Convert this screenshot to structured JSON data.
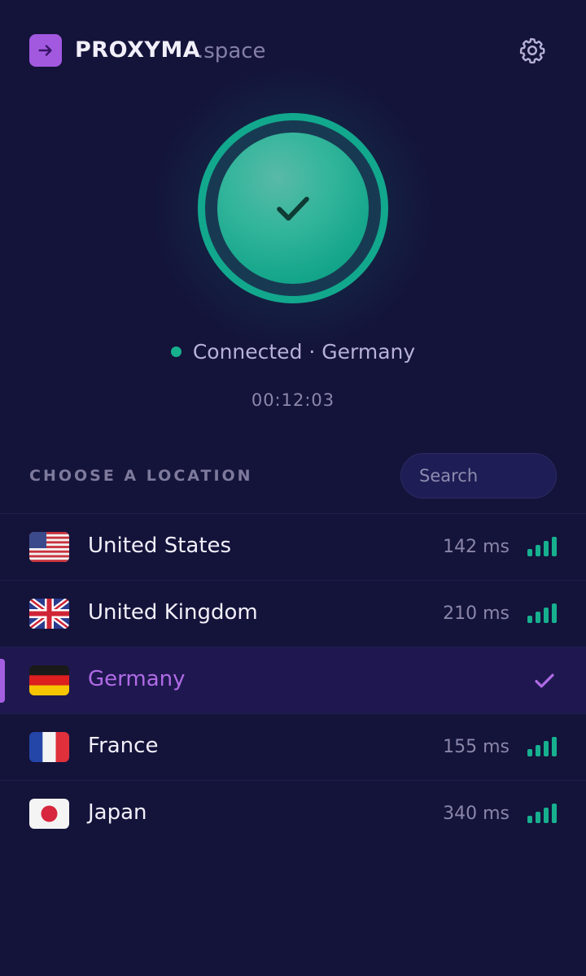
{
  "header": {
    "brand": "PROXYMA",
    "brand_suffix": ".space",
    "logo_icon": "arrow-right-icon",
    "settings_icon": "gear-icon"
  },
  "connection": {
    "status": "Connected · Germany",
    "timer": "00:12:03",
    "state_icon": "check-icon"
  },
  "locations": {
    "title": "CHOOSE A LOCATION",
    "search_placeholder": "Search",
    "items": [
      {
        "name": "United States",
        "latency": "142 ms",
        "flag": "us-flag-icon",
        "selected": false
      },
      {
        "name": "United Kingdom",
        "latency": "210 ms",
        "flag": "uk-flag-icon",
        "selected": false
      },
      {
        "name": "Germany",
        "latency": "",
        "flag": "de-flag-icon",
        "selected": true
      },
      {
        "name": "France",
        "latency": "155 ms",
        "flag": "fr-flag-icon",
        "selected": false
      },
      {
        "name": "Japan",
        "latency": "340 ms",
        "flag": "jp-flag-icon",
        "selected": false
      }
    ]
  },
  "colors": {
    "background": "#14133a",
    "accent": "#a259e0",
    "connected": "#12a88d",
    "signal": "#17b08f"
  }
}
